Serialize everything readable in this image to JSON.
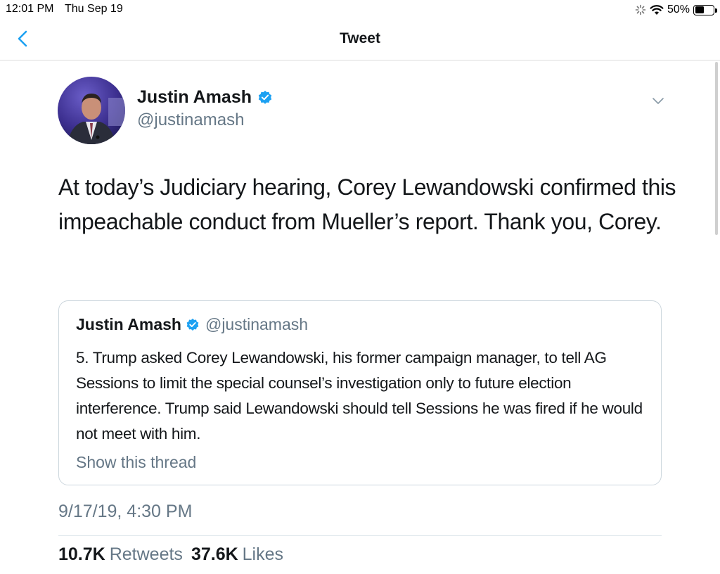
{
  "status_bar": {
    "time": "12:01 PM",
    "date": "Thu Sep 19",
    "battery": "50%",
    "battery_level": 0.5,
    "icons": [
      "activity-spinner-icon",
      "wifi-icon",
      "battery-icon"
    ]
  },
  "nav": {
    "title": "Tweet",
    "back_icon": "chevron-left-icon"
  },
  "tweet": {
    "author_name": "Justin Amash",
    "author_handle": "@justinamash",
    "verified": true,
    "text": "At today’s Judiciary hearing, Corey Lewandowski confirmed this impeachable conduct from Mueller’s report. Thank you, Corey.",
    "timestamp": "9/17/19, 4:30 PM",
    "retweets_count": "10.7K",
    "retweets_label": "Retweets",
    "likes_count": "37.6K",
    "likes_label": "Likes"
  },
  "quote": {
    "author_name": "Justin Amash",
    "author_handle": "@justinamash",
    "text": "5. Trump asked Corey Lewandowski, his former campaign manager, to tell AG Sessions to limit the special counsel’s investigation only to future election interference. Trump said Lewandowski should tell Sessions he was fired if he would not meet with him.",
    "show_thread": "Show this thread"
  },
  "colors": {
    "accent": "#1da1f2",
    "text": "#14171a",
    "secondary": "#657786",
    "border": "#ccd6dd"
  }
}
